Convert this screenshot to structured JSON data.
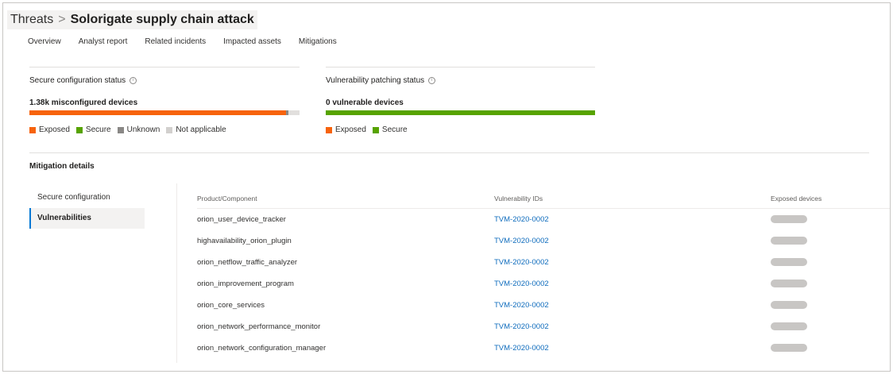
{
  "breadcrumb": {
    "root": "Threats",
    "separator": ">",
    "title": "Solorigate supply chain attack"
  },
  "tabs": [
    "Overview",
    "Analyst report",
    "Related incidents",
    "Impacted assets",
    "Mitigations"
  ],
  "secure_config": {
    "title": "Secure configuration status",
    "metric": "1.38k misconfigured devices",
    "bar": {
      "exposed_fraction": 0.95,
      "secure_fraction": 0.0,
      "unknown_fraction": 0.01,
      "na_fraction": 0.04
    },
    "legend": [
      {
        "label": "Exposed",
        "color": "#f7630c"
      },
      {
        "label": "Secure",
        "color": "#57a300"
      },
      {
        "label": "Unknown",
        "color": "#8a8886"
      },
      {
        "label": "Not applicable",
        "color": "#d2d0ce"
      }
    ]
  },
  "vuln_patching": {
    "title": "Vulnerability patching status",
    "metric": "0 vulnerable devices",
    "bar": {
      "exposed_fraction": 0.0,
      "secure_fraction": 1.0
    },
    "legend": [
      {
        "label": "Exposed",
        "color": "#f7630c"
      },
      {
        "label": "Secure",
        "color": "#57a300"
      }
    ]
  },
  "mitigation": {
    "title": "Mitigation details",
    "nav": [
      "Secure configuration",
      "Vulnerabilities"
    ],
    "active_nav": "Vulnerabilities",
    "columns": [
      "Product/Component",
      "Vulnerability IDs",
      "Exposed devices"
    ],
    "rows": [
      {
        "product": "orion_user_device_tracker",
        "vuln_id": "TVM-2020-0002"
      },
      {
        "product": "highavailability_orion_plugin",
        "vuln_id": "TVM-2020-0002"
      },
      {
        "product": "orion_netflow_traffic_analyzer",
        "vuln_id": "TVM-2020-0002"
      },
      {
        "product": "orion_improvement_program",
        "vuln_id": "TVM-2020-0002"
      },
      {
        "product": "orion_core_services",
        "vuln_id": "TVM-2020-0002"
      },
      {
        "product": "orion_network_performance_monitor",
        "vuln_id": "TVM-2020-0002"
      },
      {
        "product": "orion_network_configuration_manager",
        "vuln_id": "TVM-2020-0002"
      }
    ]
  }
}
